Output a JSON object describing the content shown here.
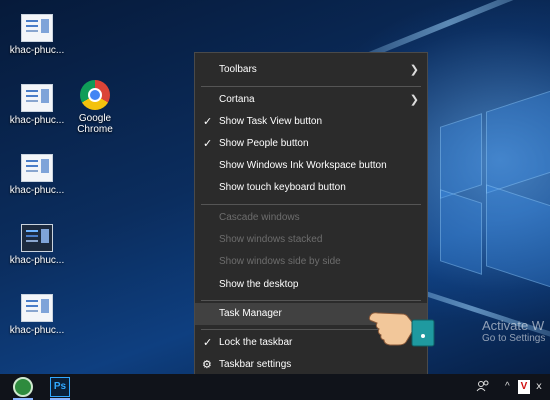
{
  "desktop": {
    "icons": [
      {
        "label": "khac-phuc...",
        "kind": "doc"
      },
      {
        "label": "khac-phuc...",
        "kind": "doc"
      },
      {
        "label": "Google Chrome",
        "kind": "chrome"
      },
      {
        "label": "khac-phuc...",
        "kind": "doc"
      },
      {
        "label": "khac-phuc...",
        "kind": "dark"
      },
      {
        "label": "khac-phuc...",
        "kind": "doc"
      }
    ],
    "watermark": {
      "line1": "Activate W",
      "line2": "Go to Settings"
    }
  },
  "context_menu": {
    "items": [
      {
        "label": "Toolbars",
        "submenu": true
      },
      {
        "label": "Cortana",
        "submenu": true
      },
      {
        "label": "Show Task View button",
        "checked": true
      },
      {
        "label": "Show People button",
        "checked": true
      },
      {
        "label": "Show Windows Ink Workspace button"
      },
      {
        "label": "Show touch keyboard button"
      },
      {
        "label": "Cascade windows",
        "disabled": true
      },
      {
        "label": "Show windows stacked",
        "disabled": true
      },
      {
        "label": "Show windows side by side",
        "disabled": true
      },
      {
        "label": "Show the desktop"
      },
      {
        "label": "Task Manager",
        "highlighted": true
      },
      {
        "label": "Lock the taskbar",
        "checked": true
      },
      {
        "label": "Taskbar settings",
        "icon": "gear-icon"
      }
    ]
  },
  "taskbar": {
    "apps": [
      "green-app-icon",
      "photoshop-icon"
    ],
    "ps_label": "Ps",
    "tray": {
      "people": "people-icon",
      "chevron": "^",
      "antivirus": "V",
      "ime": "ⅹ"
    }
  },
  "colors": {
    "menu_bg": "#2b2b2b",
    "menu_hover": "#414141",
    "taskbar": "#10131a"
  }
}
